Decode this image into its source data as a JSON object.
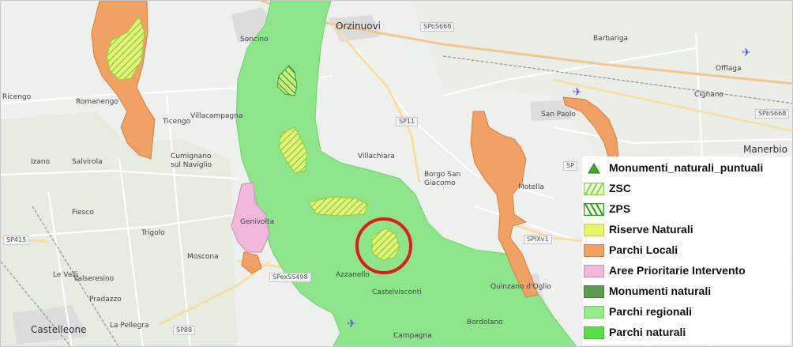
{
  "towns": {
    "soncino": "Soncino",
    "orzinuovi": "Orzinuovi",
    "barbariga": "Barbariga",
    "offlaga": "Offlaga",
    "cignano": "Cignano",
    "ricengo": "Ricengo",
    "romanengo": "Romanengo",
    "ticengo": "Ticengo",
    "villachiara": "Villachiara",
    "villacampagna": "Villacampagna",
    "cumignano": "Cumignano sul Naviglio",
    "izano": "Izano",
    "salvirola": "Salvirola",
    "fiesco": "Fiesco",
    "trigolo": "Trigolo",
    "genivolta": "Genivolta",
    "moscona": "Moscona",
    "borgo_san_giacomo": "Borgo San Giacomo",
    "motella": "Motella",
    "san_paolo": "San Paolo",
    "manerbio": "Manerbio",
    "azzanello": "Azzanello",
    "castelvisconti": "Castelvisconti",
    "quinzano": "Quinzano d'Oglio",
    "bordolano": "Bordolano",
    "campagna": "Campagna",
    "castelleone": "Castelleone",
    "la_pellegra": "La Pellegra",
    "pradazzo": "Pradazzo",
    "valseresino": "Valseresino",
    "le_valli": "Le Valli"
  },
  "roads": {
    "sp6s668": "SPbS668",
    "sp11": "SP11",
    "spexss498": "SPexSS498",
    "sp415": "SP415",
    "sp9": "SP89",
    "spixv1": "SPIXv1",
    "sp235": "SPbS668",
    "spt": "SP"
  },
  "legend": {
    "items": [
      {
        "label": "Monumenti_naturali_puntuali",
        "symbol": "triangle",
        "color": "#3fae2a"
      },
      {
        "label": "ZSC",
        "symbol": "hatch-forward",
        "color": "#7fdc3a"
      },
      {
        "label": "ZPS",
        "symbol": "hatch-back",
        "color": "#2f9a2a"
      },
      {
        "label": "Riserve Naturali",
        "symbol": "fill",
        "color": "#e7f56a"
      },
      {
        "label": "Parchi Locali",
        "symbol": "fill",
        "color": "#f0a163"
      },
      {
        "label": "Aree Prioritarie Intervento",
        "symbol": "fill",
        "color": "#f2b8db"
      },
      {
        "label": "Monumenti naturali",
        "symbol": "fill",
        "color": "#5b9c4e"
      },
      {
        "label": "Parchi regionali",
        "symbol": "fill",
        "color": "#97ea8c"
      },
      {
        "label": "Parchi naturali",
        "symbol": "fill",
        "color": "#58e04a"
      }
    ]
  },
  "colors": {
    "parco_regionale": "#8ce58a",
    "parco_locale": "#f0a163",
    "aree_prioritarie": "#f2b8db",
    "zsc_hatch": "#c6e63b",
    "highlight_circle": "#e01b1b",
    "basemap": "#eef0ee"
  }
}
